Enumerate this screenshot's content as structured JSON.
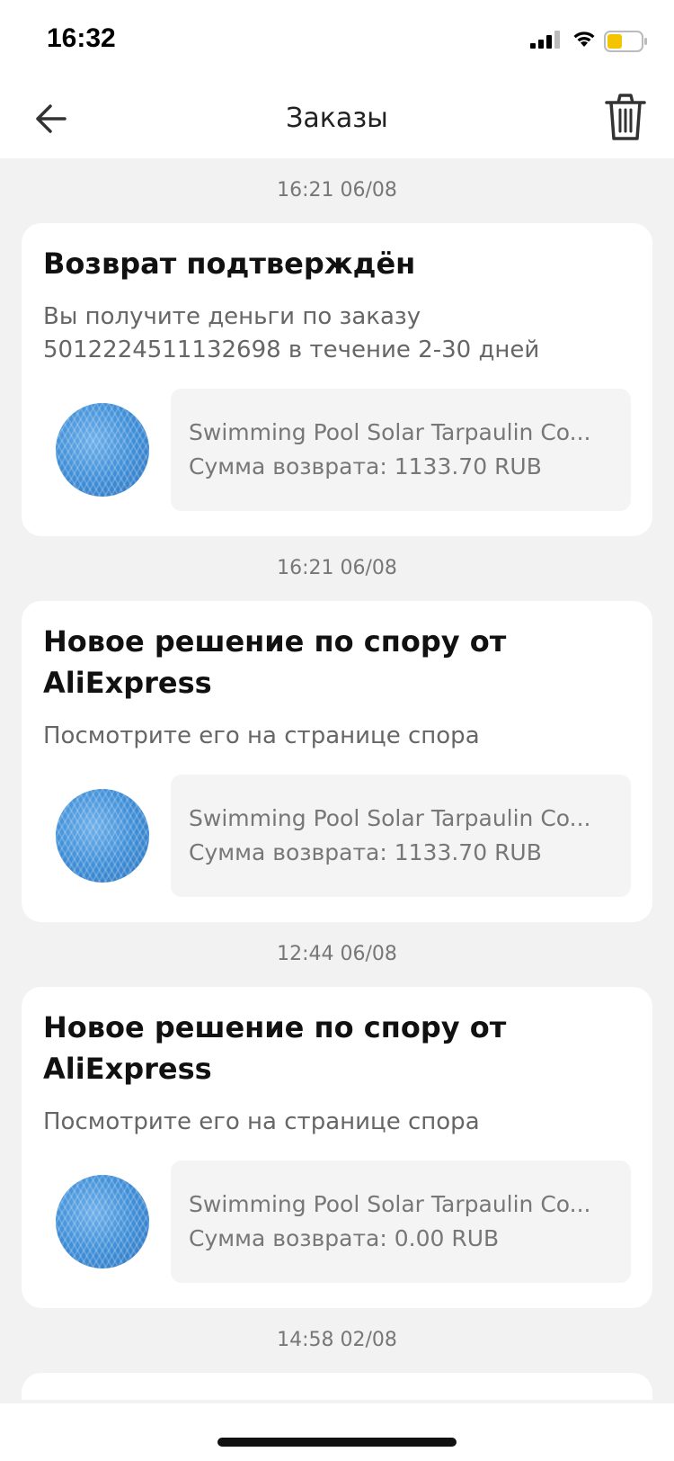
{
  "status_bar": {
    "time": "16:32"
  },
  "header": {
    "title": "Заказы"
  },
  "notifications": [
    {
      "timestamp": "16:21 06/08",
      "title": "Возврат подтверждён",
      "message": "Вы получите деньги по заказу 5012224511132698 в течение 2-30 дней",
      "product_name": "Swimming Pool Solar Tarpaulin Co...",
      "refund": "Сумма возврата: 1133.70 RUB"
    },
    {
      "timestamp": "16:21 06/08",
      "title": "Новое решение по спору от AliExpress",
      "message": "Посмотрите его на странице спора",
      "product_name": "Swimming Pool Solar Tarpaulin Co...",
      "refund": "Сумма возврата: 1133.70 RUB"
    },
    {
      "timestamp": "12:44 06/08",
      "title": "Новое решение по спору от AliExpress",
      "message": "Посмотрите его на странице спора",
      "product_name": "Swimming Pool Solar Tarpaulin Co...",
      "refund": "Сумма возврата: 0.00 RUB"
    }
  ],
  "next_timestamp": "14:58 02/08",
  "colors": {
    "accent_product": "#3f8fd8",
    "background": "#f2f2f2",
    "card": "#ffffff"
  },
  "icons": [
    "back-arrow-icon",
    "trash-icon",
    "signal-icon",
    "wifi-icon",
    "battery-icon"
  ]
}
